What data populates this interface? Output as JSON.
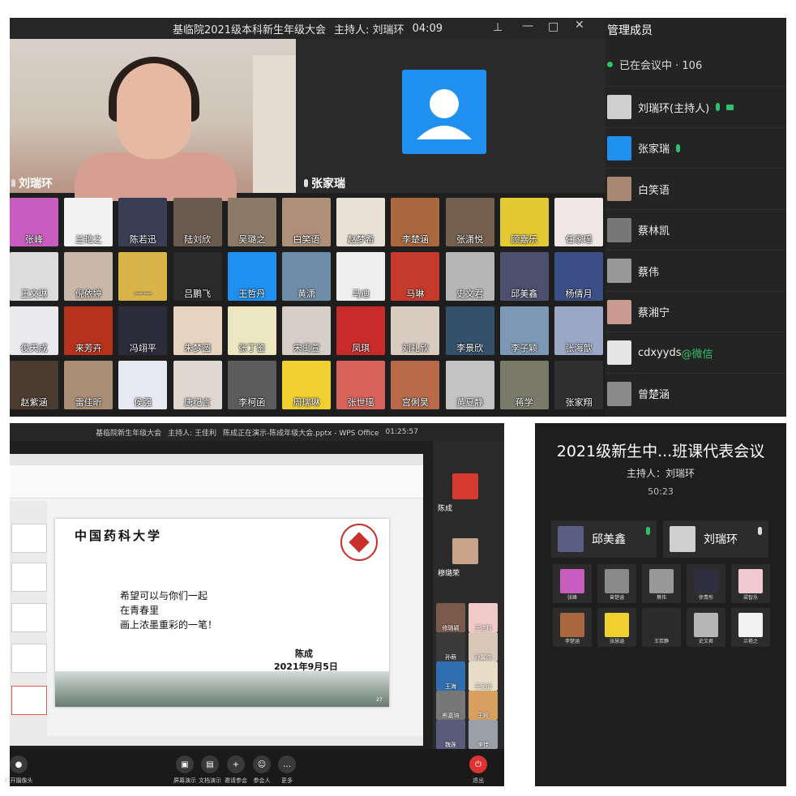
{
  "panel1": {
    "title": "基临院2021级本科新生年级大会",
    "host": "主持人: 刘瑞环",
    "time": "04:09",
    "video_left_name": "刘瑞环",
    "video_right_name": "张家瑞",
    "grid": [
      {
        "name": "张峰",
        "color": "#c95dbf"
      },
      {
        "name": "兰艳之",
        "color": "#f2f2f2"
      },
      {
        "name": "陈若迅",
        "color": "#3a3e55"
      },
      {
        "name": "陆刘欣",
        "color": "#6b5a4e"
      },
      {
        "name": "吴璐之",
        "color": "#8c7a66"
      },
      {
        "name": "白笑语",
        "color": "#ad8f7a"
      },
      {
        "name": "赵梦希",
        "color": "#e7e0d4"
      },
      {
        "name": "李楚涵",
        "color": "#a9683e"
      },
      {
        "name": "张潇悦",
        "color": "#75604f"
      },
      {
        "name": "顾嘉乐",
        "color": "#e4c932"
      },
      {
        "name": "任家瑶",
        "color": "#f0e6e6"
      },
      {
        "name": "王文琳",
        "color": "#dcdcdc"
      },
      {
        "name": "倪依婷",
        "color": "#c9b7a8"
      },
      {
        "name": "一一",
        "color": "#d8b44a"
      },
      {
        "name": "吕鹏飞",
        "color": "#2a2a2a"
      },
      {
        "name": "王哲丹",
        "color": "#1f8ff0"
      },
      {
        "name": "黄潇",
        "color": "#6f8ca8"
      },
      {
        "name": "马迪",
        "color": "#eeeeee"
      },
      {
        "name": "马琳",
        "color": "#c43a2c"
      },
      {
        "name": "史文君",
        "color": "#b6b6b6"
      },
      {
        "name": "邱美鑫",
        "color": "#4e4f6e"
      },
      {
        "name": "杨倩月",
        "color": "#3b4f86"
      },
      {
        "name": "俊天成",
        "color": "#e9e9ee"
      },
      {
        "name": "来芳卉",
        "color": "#b7321d"
      },
      {
        "name": "冯翊平",
        "color": "#2b2b3a"
      },
      {
        "name": "朱梦圆",
        "color": "#e6d4c0"
      },
      {
        "name": "张丁鉴",
        "color": "#ece7c0"
      },
      {
        "name": "宋禹萱",
        "color": "#d6cfc7"
      },
      {
        "name": "凤琪",
        "color": "#c92b2b"
      },
      {
        "name": "刘礼欣",
        "color": "#d8ccc0"
      },
      {
        "name": "李景欣",
        "color": "#35506b"
      },
      {
        "name": "李子颖",
        "color": "#7c98b4"
      },
      {
        "name": "张海歆",
        "color": "#9aa7c6"
      },
      {
        "name": "赵紫涵",
        "color": "#4c3b30"
      },
      {
        "name": "雷佳昕",
        "color": "#a98d74"
      },
      {
        "name": "侯强",
        "color": "#e8e8f2"
      },
      {
        "name": "唐纪言",
        "color": "#e0d8d0"
      },
      {
        "name": "李柯函",
        "color": "#5c5c5c"
      },
      {
        "name": "周瑞琳",
        "color": "#f0d030"
      },
      {
        "name": "张世瑶",
        "color": "#d8635a"
      },
      {
        "name": "宫俐昊",
        "color": "#b86a4a"
      },
      {
        "name": "黄夏静",
        "color": "#c2c2c2"
      },
      {
        "name": "蒋学",
        "color": "#7a7a6a"
      },
      {
        "name": "张家翔",
        "color": "#2f2f2f"
      }
    ]
  },
  "sidebar1": {
    "header": "管理成员",
    "in_meeting": "已在会议中 · 106",
    "members": [
      {
        "name": "刘瑞环(主持人)",
        "color": "#cfcfcf",
        "mic": true,
        "cam": true
      },
      {
        "name": "张家瑞",
        "color": "#1f8ff0",
        "mic": true,
        "cam": false
      },
      {
        "name": "白笑语",
        "color": "#a88872",
        "mic": false,
        "cam": false
      },
      {
        "name": "蔡林凯",
        "color": "#777777",
        "mic": false,
        "cam": false
      },
      {
        "name": "蔡伟",
        "color": "#999999",
        "mic": false,
        "cam": false
      },
      {
        "name": "蔡湘宁",
        "color": "#c89a90",
        "mic": false,
        "cam": false
      },
      {
        "name": "cdxyyds",
        "suffix": "@微信",
        "color": "#e5e5e5",
        "mic": false,
        "cam": false
      },
      {
        "name": "曾楚涵",
        "color": "#8a8a8a",
        "mic": false,
        "cam": false
      }
    ]
  },
  "panel2": {
    "title": "基临院新生年级大会",
    "host": "主持人: 王佳利",
    "presenting": "陈成正在演示-陈成年级大会.pptx - WPS Office",
    "time": "01:25:57",
    "slide": {
      "university": "中国药科大学",
      "line1": "希望可以与你们一起",
      "line2": "在青春里",
      "line3": "画上浓墨重彩的一笔！",
      "author": "陈成",
      "date": "2021年9月5日",
      "page": "27"
    },
    "side_main": [
      {
        "name": "陈成",
        "color": "#d43b2e"
      },
      {
        "name": "穆璐荣",
        "color": "#c9a48a"
      }
    ],
    "side_tiles": [
      {
        "name": "修璐颖",
        "color": "#7a5a4a"
      },
      {
        "name": "王佳利",
        "color": "#f0c8c8"
      },
      {
        "name": "孙萌",
        "color": "#3a3a3a"
      },
      {
        "name": "孙馨伟",
        "color": "#d9c8b8"
      },
      {
        "name": "王海",
        "color": "#2f6fb0"
      },
      {
        "name": "王奥朋",
        "color": "#e6dcc8"
      },
      {
        "name": "熊嘉琦",
        "color": "#777777"
      },
      {
        "name": "王辉",
        "color": "#d8a060"
      },
      {
        "name": "魏莲",
        "color": "#5a5a7a"
      },
      {
        "name": "李佳",
        "color": "#9aa0a8"
      }
    ],
    "bottom": [
      {
        "label": "打开摄像头",
        "icon": "●"
      },
      {
        "label": "屏幕演示",
        "icon": "▣"
      },
      {
        "label": "文档演示",
        "icon": "▤"
      },
      {
        "label": "邀请参会",
        "icon": "+"
      },
      {
        "label": "参会人",
        "icon": "☺"
      },
      {
        "label": "更多",
        "icon": "…"
      },
      {
        "label": "退出",
        "icon": "⏻"
      }
    ]
  },
  "panel3": {
    "title": "2021级新生中...班课代表会议",
    "host": "主持人：刘瑞环",
    "time": "50:23",
    "main": [
      {
        "name": "邱美鑫",
        "color": "#5a5e84",
        "mic": "green"
      },
      {
        "name": "刘瑞环",
        "color": "#cfcfcf",
        "mic": "grey"
      }
    ],
    "small": [
      {
        "name": "张峰",
        "color": "#c95dbf"
      },
      {
        "name": "曾楚涵",
        "color": "#8a8a8a"
      },
      {
        "name": "蔡伟",
        "color": "#999999"
      },
      {
        "name": "徐青彤",
        "color": "#2f2f3f"
      },
      {
        "name": "梁智乐",
        "color": "#f0c8d0"
      },
      {
        "name": "李楚涵",
        "color": "#a9683e"
      },
      {
        "name": "张慧涵",
        "color": "#f0d030"
      },
      {
        "name": "王若静",
        "color": "#2a2a2a"
      },
      {
        "name": "史文君",
        "color": "#b6b6b6"
      },
      {
        "name": "兰艳之",
        "color": "#f2f2f2"
      }
    ]
  }
}
